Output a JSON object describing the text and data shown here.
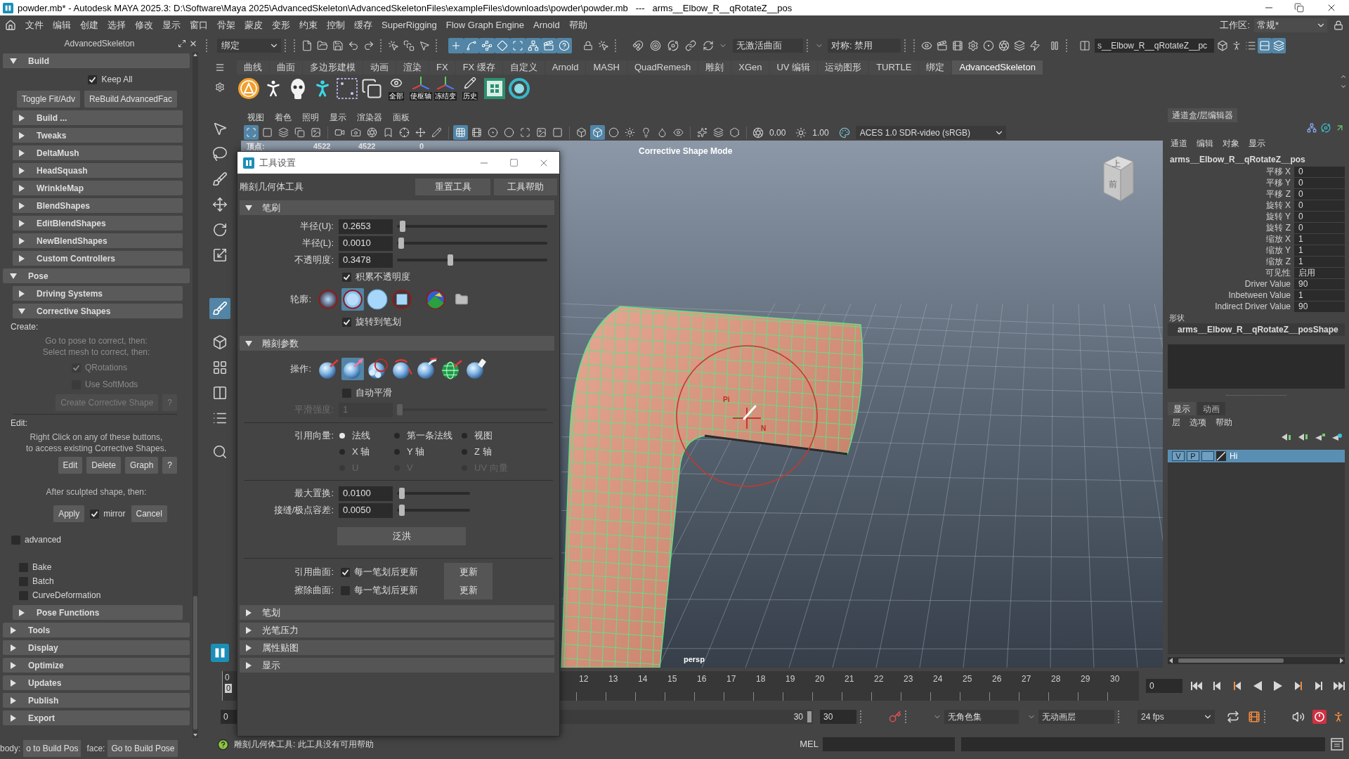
{
  "window": {
    "title": "powder.mb* - Autodesk MAYA 2025.3: D:\\Software\\Maya 2025\\AdvancedSkeleton\\AdvancedSkeletonFiles\\exampleFiles\\downloads\\powder\\powder.mb   ---   arms__Elbow_R__qRotateZ__pos"
  },
  "menu_bar": {
    "items": [
      "文件",
      "编辑",
      "创建",
      "选择",
      "修改",
      "显示",
      "窗口",
      "骨架",
      "蒙皮",
      "变形",
      "约束",
      "控制",
      "缓存",
      "SuperRigging",
      "Flow Graph Engine",
      "Arnold",
      "帮助"
    ],
    "workspace": {
      "label": "工作区:",
      "value": "常规*"
    }
  },
  "status_line": {
    "menu_set": "绑定",
    "snap_toggles": [
      {
        "on": true
      },
      {
        "on": true
      },
      {
        "on": true
      },
      {
        "on": true
      },
      {
        "on": true
      },
      {
        "on": true
      },
      {
        "on": true
      },
      {
        "on": true
      }
    ],
    "live_surface": "无激活曲面",
    "symmetry": "对称: 禁用",
    "object_name": "s__Elbow_R__qRotateZ__pc",
    "panel_toggles": [
      {
        "on": false
      },
      {
        "on": false
      },
      {
        "on": false
      },
      {
        "on": true
      },
      {
        "on": true
      }
    ]
  },
  "shelf": {
    "tabs": [
      {
        "label": "曲线",
        "selected": false
      },
      {
        "label": "曲面",
        "selected": false
      },
      {
        "label": "多边形建模",
        "selected": false
      },
      {
        "label": "动画",
        "selected": false
      },
      {
        "label": "渲染",
        "selected": false
      },
      {
        "label": "FX",
        "selected": false
      },
      {
        "label": "FX 缓存",
        "selected": false
      },
      {
        "label": "自定义",
        "selected": false
      },
      {
        "label": "Arnold",
        "selected": false
      },
      {
        "label": "MASH",
        "selected": false
      },
      {
        "label": "QuadRemesh",
        "selected": false
      },
      {
        "label": "雕刻",
        "selected": false
      },
      {
        "label": "XGen",
        "selected": false
      },
      {
        "label": "UV 编辑",
        "selected": false
      },
      {
        "label": "运动图形",
        "selected": false
      },
      {
        "label": "TURTLE",
        "selected": false
      },
      {
        "label": "绑定",
        "selected": false
      },
      {
        "label": "AdvancedSkeleton",
        "selected": true
      }
    ],
    "icon_labels": [
      "全部",
      "使枢轴",
      "冻结变",
      "历史"
    ]
  },
  "toolbox": [
    {
      "selected": false
    },
    {
      "selected": false
    },
    {
      "selected": false
    },
    {
      "selected": false
    },
    {
      "selected": false
    },
    {
      "selected": false
    },
    {
      "selected": true
    },
    {
      "selected": false
    },
    {
      "selected": false
    },
    {
      "selected": false
    },
    {
      "selected": false
    },
    {
      "selected": false
    }
  ],
  "left_panel": {
    "title": "AdvancedSkeleton",
    "items": [
      {
        "kind": "section",
        "label": "Build",
        "expanded": true,
        "items": [
          {
            "kind": "centered_row",
            "items": [
              {
                "kind": "checkbox",
                "label": "Keep All",
                "checked": true
              }
            ]
          },
          {
            "kind": "row",
            "items": [
              {
                "kind": "button",
                "label": "Toggle Fit/Adv"
              },
              {
                "kind": "button",
                "label": "ReBuild AdvancedFac"
              }
            ]
          },
          {
            "kind": "section",
            "label": "Build ...",
            "expanded": false
          },
          {
            "kind": "section",
            "label": "Tweaks",
            "expanded": false
          },
          {
            "kind": "section",
            "label": "DeltaMush",
            "expanded": false
          },
          {
            "kind": "section",
            "label": "HeadSquash",
            "expanded": false
          },
          {
            "kind": "section",
            "label": "WrinkleMap",
            "expanded": false
          },
          {
            "kind": "section",
            "label": "BlendShapes",
            "expanded": false
          },
          {
            "kind": "section",
            "label": "EditBlendShapes",
            "expanded": false
          },
          {
            "kind": "section",
            "label": "NewBlendShapes",
            "expanded": false
          },
          {
            "kind": "section",
            "label": "Custom Controllers",
            "expanded": false
          }
        ]
      },
      {
        "kind": "section",
        "label": "Pose",
        "expanded": true,
        "items": [
          {
            "kind": "section",
            "label": "Driving Systems",
            "expanded": false
          },
          {
            "kind": "section",
            "label": "Corrective Shapes",
            "expanded": true,
            "items": [
              {
                "kind": "heading",
                "text": "Create:"
              },
              {
                "kind": "note",
                "lines": [
                  "Go to pose to correct, then:",
                  "Select mesh to correct, then:"
                ],
                "disabled": true
              },
              {
                "kind": "checkbox",
                "label": "QRotations",
                "checked": true,
                "disabled": true
              },
              {
                "kind": "checkbox",
                "label": "Use SoftMods",
                "checked": false,
                "disabled": true
              },
              {
                "kind": "row",
                "items": [
                  {
                    "kind": "button",
                    "label": "Create Corrective Shape",
                    "disabled": true
                  },
                  {
                    "kind": "button",
                    "label": "?",
                    "disabled": true
                  }
                ]
              },
              {
                "kind": "divider"
              },
              {
                "kind": "heading",
                "text": "Edit:"
              },
              {
                "kind": "note",
                "lines": [
                  "Right Click on any of these buttons,",
                  "to access existing Corrective Shapes."
                ],
                "disabled": false
              },
              {
                "kind": "row",
                "items": [
                  {
                    "kind": "button",
                    "label": "Edit",
                    "disabled": false
                  },
                  {
                    "kind": "button",
                    "label": "Delete",
                    "disabled": false
                  },
                  {
                    "kind": "button",
                    "label": "Graph",
                    "disabled": false
                  },
                  {
                    "kind": "button",
                    "label": "?",
                    "disabled": false
                  }
                ]
              },
              {
                "kind": "note",
                "lines": [
                  "After sculpted shape, then:"
                ],
                "disabled": false
              },
              {
                "kind": "centered_row",
                "items": [
                  {
                    "kind": "button",
                    "label": "Apply"
                  },
                  {
                    "kind": "checkbox",
                    "label": "mirror",
                    "checked": true
                  },
                  {
                    "kind": "button",
                    "label": "Cancel"
                  }
                ]
              }
            ]
          },
          {
            "kind": "checkbox",
            "label": "advanced",
            "checked": false
          },
          {
            "kind": "group",
            "items": [
              {
                "kind": "checkbox",
                "label": "Bake",
                "checked": false
              },
              {
                "kind": "checkbox",
                "label": "Batch",
                "checked": false
              },
              {
                "kind": "checkbox",
                "label": "CurveDeformation",
                "checked": false
              }
            ]
          },
          {
            "kind": "section",
            "label": "Pose Functions",
            "expanded": false
          }
        ]
      },
      {
        "kind": "section",
        "label": "Tools",
        "expanded": false
      },
      {
        "kind": "section",
        "label": "Display",
        "expanded": false
      },
      {
        "kind": "section",
        "label": "Optimize",
        "expanded": false
      },
      {
        "kind": "section",
        "label": "Updates",
        "expanded": false
      },
      {
        "kind": "section",
        "label": "Publish",
        "expanded": false
      },
      {
        "kind": "section",
        "label": "Export",
        "expanded": false
      }
    ],
    "footer": {
      "body_label": "body:",
      "body_button": "o to Build Pos",
      "face_label": "face:",
      "face_button": "Go to Build Pose"
    }
  },
  "viewport": {
    "menu": [
      "视图",
      "着色",
      "照明",
      "显示",
      "渲染器",
      "面板"
    ],
    "icon_toggles": [
      {
        "on": true
      },
      {
        "on": false
      },
      {
        "on": false
      },
      {
        "on": false
      },
      {
        "on": false
      },
      {
        "on": false
      },
      {
        "on": false
      },
      {
        "on": false
      },
      {
        "on": false
      },
      {
        "on": false
      },
      {
        "on": false
      },
      {
        "on": false
      },
      {
        "on": true
      },
      {
        "on": false
      },
      {
        "on": false
      },
      {
        "on": false
      },
      {
        "on": false
      },
      {
        "on": false
      },
      {
        "on": false
      },
      {
        "on": false
      },
      {
        "on": true
      },
      {
        "on": false
      },
      {
        "on": false
      },
      {
        "on": false
      },
      {
        "on": false
      },
      {
        "on": false
      },
      {
        "on": false
      },
      {
        "on": false
      },
      {
        "on": false
      }
    ],
    "exposure": "0.00",
    "gamma": "1.00",
    "color_space": "ACES 1.0 SDR-video (sRGB)",
    "hud": {
      "label": "顶点:",
      "values": [
        "4522",
        "4522",
        "0"
      ]
    },
    "mode_label": "Corrective Shape Mode",
    "camera": "persp",
    "view_cube": {
      "top": "上",
      "front": "前"
    },
    "brush_marks": [
      "Pi",
      "N"
    ]
  },
  "tool_settings": {
    "title": "工具设置",
    "tool_name": "雕刻几何体工具",
    "buttons": [
      "重置工具",
      "工具帮助"
    ],
    "sections": [
      {
        "label": "笔刷",
        "expanded": true,
        "rows": [
          {
            "kind": "slider",
            "label": "半径(U):",
            "value": "0.2653",
            "level": 0.02,
            "disabled": false
          },
          {
            "kind": "slider",
            "label": "半径(L):",
            "value": "0.0010",
            "level": 0.01,
            "disabled": false
          },
          {
            "kind": "slider",
            "label": "不透明度:",
            "value": "0.3478",
            "level": 0.35,
            "disabled": false
          },
          {
            "kind": "checkbox",
            "label": "积累不透明度",
            "checked": true
          },
          {
            "kind": "profile_choice",
            "label": "轮廓:",
            "options": [
              {
                "selected": false
              },
              {
                "selected": true
              },
              {
                "selected": false
              },
              {
                "selected": false
              },
              {
                "selected": false
              }
            ]
          },
          {
            "kind": "checkbox",
            "label": "旋转到笔划",
            "checked": true
          }
        ]
      },
      {
        "label": "雕刻参数",
        "expanded": true,
        "rows": [
          {
            "kind": "operation_choice",
            "label": "操作:",
            "options": [
              {
                "selected": false
              },
              {
                "selected": true
              },
              {
                "selected": false
              },
              {
                "selected": false
              },
              {
                "selected": false
              },
              {
                "selected": false
              },
              {
                "selected": false
              }
            ]
          },
          {
            "kind": "checkbox",
            "label": "自动平滑",
            "checked": false
          },
          {
            "kind": "slider",
            "label": "平滑强度:",
            "value": "1",
            "level": 0,
            "disabled": true
          },
          {
            "kind": "divider"
          },
          {
            "kind": "radio_grid",
            "label": "引用向量:",
            "options": [
              {
                "label": "法线",
                "selected": true,
                "disabled": false
              },
              {
                "label": "第一条法线",
                "selected": false,
                "disabled": false
              },
              {
                "label": "视图",
                "selected": false,
                "disabled": false
              },
              {
                "label": "X 轴",
                "selected": false,
                "disabled": false
              },
              {
                "label": "Y 轴",
                "selected": false,
                "disabled": false
              },
              {
                "label": "Z 轴",
                "selected": false,
                "disabled": false
              },
              {
                "label": "U",
                "selected": false,
                "disabled": true
              },
              {
                "label": "V",
                "selected": false,
                "disabled": true
              },
              {
                "label": "UV 向量",
                "selected": false,
                "disabled": true
              }
            ]
          },
          {
            "kind": "divider"
          },
          {
            "kind": "short_slider",
            "label": "最大置换:",
            "value": "0.0100",
            "level": 0.03,
            "disabled": false
          },
          {
            "kind": "short_slider",
            "label": "接缝/极点容差:",
            "value": "0.0050",
            "level": 0.03,
            "disabled": false
          },
          {
            "kind": "button",
            "label": "泛洪"
          },
          {
            "kind": "divider"
          },
          {
            "kind": "surface",
            "label": "引用曲面:",
            "option": "每一笔划后更新",
            "checked": true,
            "button": "更新"
          },
          {
            "kind": "surface",
            "label": "擦除曲面:",
            "option": "每一笔划后更新",
            "checked": false,
            "button": "更新"
          }
        ]
      },
      {
        "label": "笔划",
        "expanded": false
      },
      {
        "label": "光笔压力",
        "expanded": false
      },
      {
        "label": "属性贴图",
        "expanded": false
      },
      {
        "label": "显示",
        "expanded": false
      }
    ]
  },
  "channel_box": {
    "tab": "通道盒/层编辑器",
    "menu": [
      "通道",
      "编辑",
      "对象",
      "显示"
    ],
    "object": "arms__Elbow_R__qRotateZ__pos",
    "channels": [
      {
        "name": "平移 X",
        "value": "0"
      },
      {
        "name": "平移 Y",
        "value": "0"
      },
      {
        "name": "平移 Z",
        "value": "0"
      },
      {
        "name": "旋转 X",
        "value": "0"
      },
      {
        "name": "旋转 Y",
        "value": "0"
      },
      {
        "name": "旋转 Z",
        "value": "0"
      },
      {
        "name": "缩放 X",
        "value": "1"
      },
      {
        "name": "缩放 Y",
        "value": "1"
      },
      {
        "name": "缩放 Z",
        "value": "1"
      },
      {
        "name": "可见性",
        "value": "启用"
      },
      {
        "name": "Driver Value",
        "value": "90"
      },
      {
        "name": "Inbetween Value",
        "value": "1"
      },
      {
        "name": "Indirect Driver Value",
        "value": "90"
      }
    ],
    "shape_heading": "形状",
    "shape": "arms__Elbow_R__qRotateZ__posShape"
  },
  "layer_editor": {
    "tabs": [
      {
        "label": "显示",
        "selected": true
      },
      {
        "label": "动画",
        "selected": false
      }
    ],
    "menu": [
      "层",
      "选项",
      "帮助"
    ],
    "layers": [
      {
        "visibility": "V",
        "playback": "P",
        "name": "Hi",
        "selected": true
      }
    ]
  },
  "timeline": {
    "start_label": "0",
    "current_marker": "0",
    "labels": [
      "12",
      "13",
      "14",
      "15",
      "16",
      "17",
      "18",
      "19",
      "20",
      "21",
      "22",
      "23",
      "24",
      "25",
      "26",
      "27",
      "28",
      "29",
      "30"
    ],
    "current_time": "0"
  },
  "range_slider": {
    "start": "0",
    "range_end": "30",
    "end": "30",
    "character_set": "无角色集",
    "anim_layer": "无动画层",
    "fps": "24 fps"
  },
  "help_line": {
    "message": "雕刻几何体工具: 此工具没有可用帮助",
    "command_language": "MEL"
  }
}
